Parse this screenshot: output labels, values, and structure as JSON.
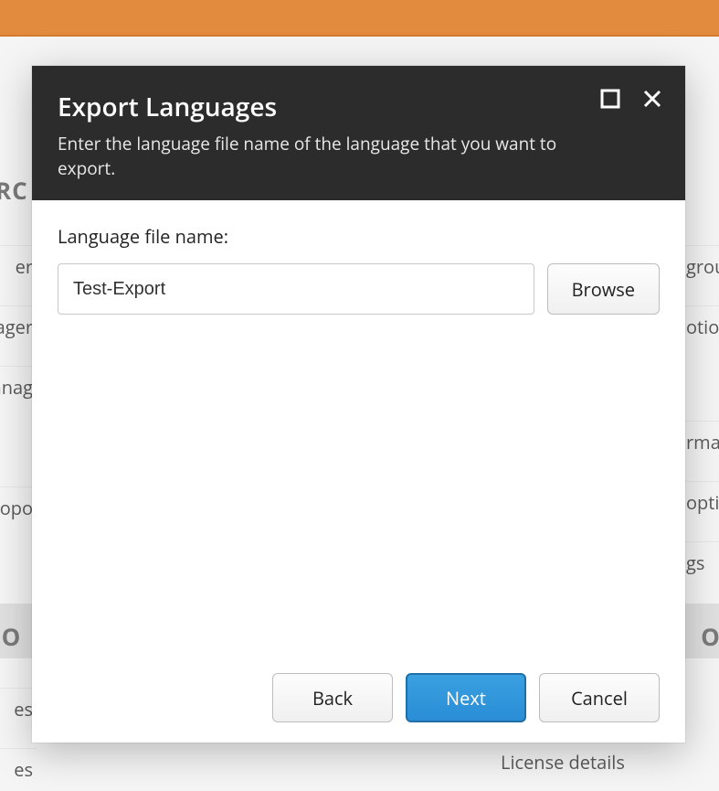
{
  "modal": {
    "title": "Export Languages",
    "subtitle": "Enter the language file name of the language that you want to export.",
    "body": {
      "field_label": "Language file name:",
      "filename_value": "Test-Export",
      "browse_label": "Browse"
    },
    "footer": {
      "back": "Back",
      "next": "Next",
      "cancel": "Cancel"
    }
  },
  "background": {
    "heading_left_1": "ARC",
    "heading_left_2": "TIO",
    "heading_right": "ON",
    "items_left": [
      "er",
      "ager",
      "anag",
      "opo",
      "es",
      "es"
    ],
    "items_right": [
      "grou",
      "otion",
      "rma",
      "opti",
      "gs"
    ],
    "license": "License details"
  }
}
